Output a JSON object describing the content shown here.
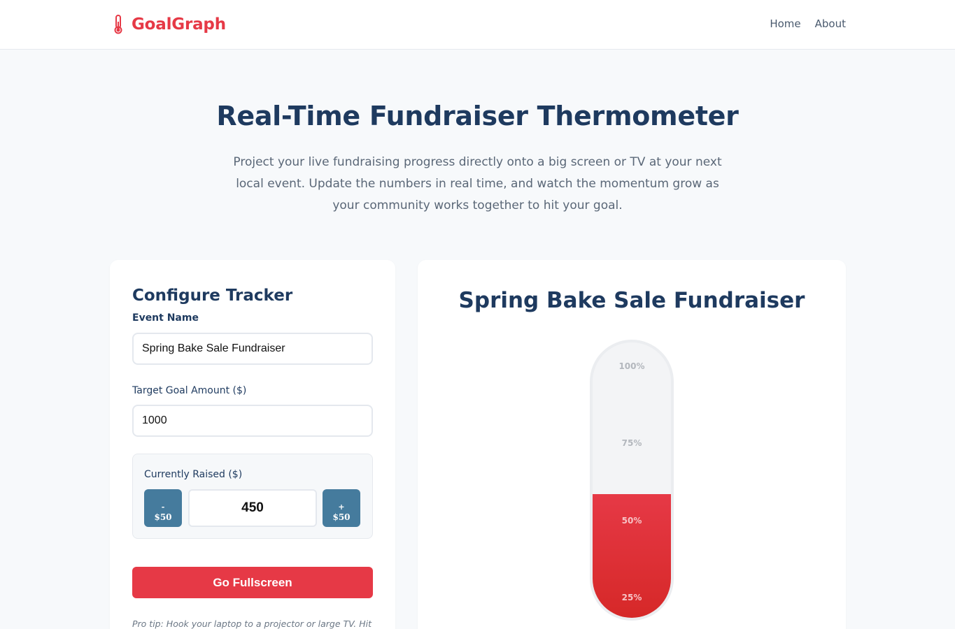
{
  "nav": {
    "brand": "GoalGraph",
    "brand_icon": "thermometer-icon",
    "links": [
      "Home",
      "About"
    ]
  },
  "hero": {
    "title": "Real-Time Fundraiser Thermometer",
    "subtitle": "Project your live fundraising progress directly onto a big screen or TV at your next local event. Update the numbers in real time, and watch the momentum grow as your community works together to hit your goal."
  },
  "config": {
    "title": "Configure Tracker",
    "event_label": "Event Name",
    "event_value": "Spring Bake Sale Fundraiser",
    "goal_label": "Target Goal Amount ($)",
    "goal_value": "1000",
    "raised_label": "Currently Raised ($)",
    "raised_value": "450",
    "minus_symbol": "-",
    "minus_amount": "$50",
    "plus_symbol": "+",
    "plus_amount": "$50",
    "fullscreen_label": "Go Fullscreen",
    "pro_tip": "Pro tip: Hook your laptop to a projector or large TV. Hit"
  },
  "display": {
    "title": "Spring Bake Sale Fundraiser",
    "progress": 0.45,
    "ticks": [
      "100%",
      "75%",
      "50%",
      "25%"
    ]
  },
  "colors": {
    "brand": "#e63946",
    "navy": "#1e3a5f",
    "steel": "#457b9d",
    "background": "#f7f9fb"
  }
}
